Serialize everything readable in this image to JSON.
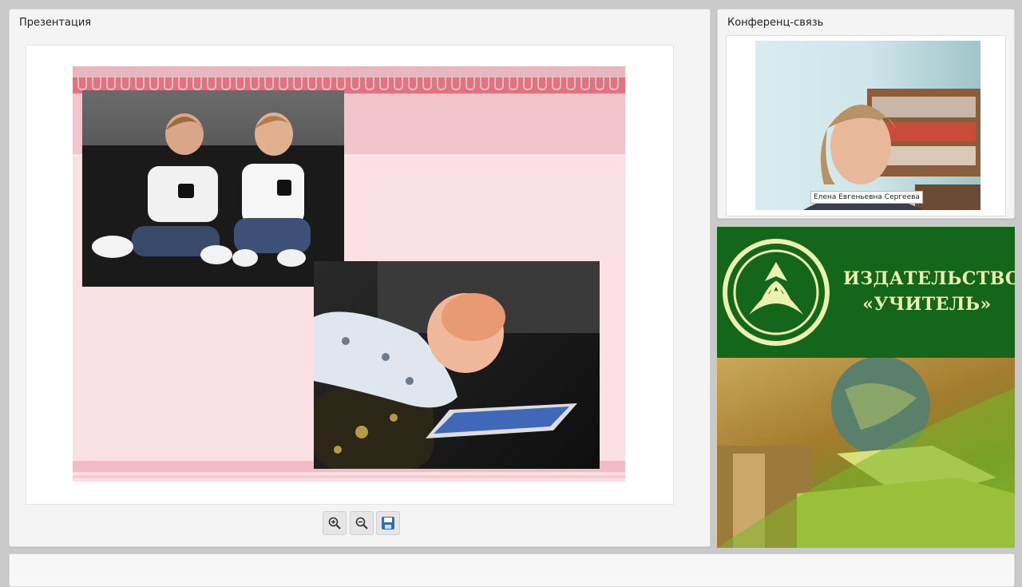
{
  "presentation": {
    "title": "Презентация",
    "toolbar": {
      "zoom_in": "zoom-in-icon",
      "zoom_out": "zoom-out-icon",
      "save": "save-icon"
    }
  },
  "conference": {
    "title": "Конференц-связь",
    "participant_name": "Елена Евгеньевна Сергеева"
  },
  "ad": {
    "line1": "ИЗДАТЕЛЬСТВО",
    "line2": "«УЧИТЕЛЬ»"
  },
  "colors": {
    "logo_green": "#14661a",
    "logo_text": "#ecf1b0",
    "slide_pink": "#fadfe5"
  }
}
